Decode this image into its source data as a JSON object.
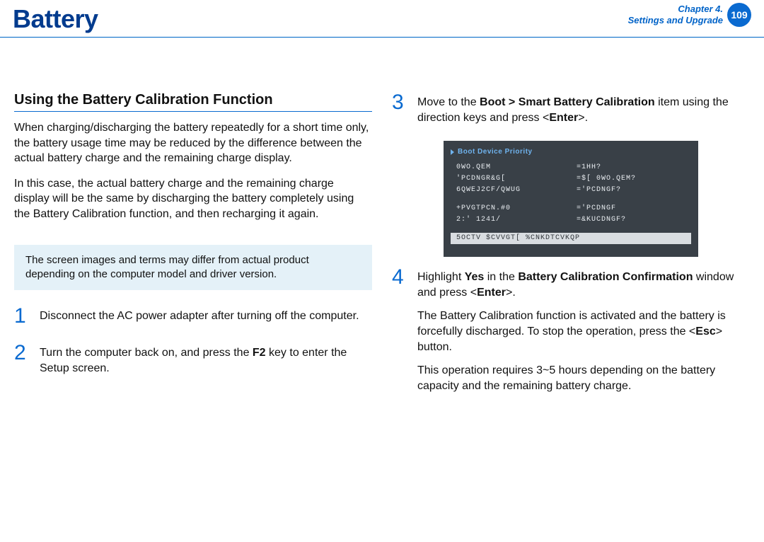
{
  "header": {
    "title": "Battery",
    "chapter_line1": "Chapter 4.",
    "chapter_line2": "Settings and Upgrade",
    "page_number": "109"
  },
  "left": {
    "section_heading": "Using the Battery Calibration Function",
    "para1": "When charging/discharging the battery repeatedly for a short time only, the battery usage time may be reduced by the difference between the actual battery charge and the remaining charge display.",
    "para2": "In this case, the actual battery charge and the remaining charge display will be the same by discharging the battery completely using the Battery Calibration function, and then recharging it again.",
    "note": "The screen images and terms may differ from actual product depending on the computer model and driver version.",
    "steps": [
      {
        "num": "1",
        "text": "Disconnect the AC power adapter after turning off the computer."
      },
      {
        "num": "2",
        "text_prefix": "Turn the computer back on, and press the ",
        "bold": "F2",
        "text_suffix": " key to enter the Setup screen."
      }
    ]
  },
  "right": {
    "step3": {
      "num": "3",
      "prefix": "Move to the ",
      "bold1": "Boot > Smart Battery Calibration",
      "mid": " item using the direction keys and press <",
      "bold2": "Enter",
      "suffix": ">."
    },
    "bios": {
      "title": "Boot Device Priority",
      "rows": [
        {
          "k": "0WO.QEM",
          "v": "=1HH?"
        },
        {
          "k": "'PCDNGR&G[",
          "v": "=$[ 0WO.QEM?"
        },
        {
          "k": "6QWEJ2CF/QWUG",
          "v": "='PCDNGF?"
        }
      ],
      "rows2": [
        {
          "k": "+PVGTPCN.#0",
          "v": "='PCDNGF"
        },
        {
          "k": "2:' 1241/",
          "v": "=&KUCDNGF?"
        }
      ],
      "hl": "5OCTV $CVVGT[ %CNKDTCVKQP"
    },
    "step4": {
      "num": "4",
      "line1_prefix": "Highlight ",
      "line1_b1": "Yes",
      "line1_mid": " in the ",
      "line1_b2": "Battery Calibration Confirmation",
      "line1_suffix": " window and press <",
      "line1_b3": "Enter",
      "line1_end": ">.",
      "line2_prefix": "The Battery Calibration function is activated and the battery is forcefully discharged. To stop the operation, press the <",
      "line2_b": "Esc",
      "line2_suffix": "> button.",
      "line3": "This operation requires 3~5 hours depending on the battery capacity and the remaining battery charge."
    }
  }
}
